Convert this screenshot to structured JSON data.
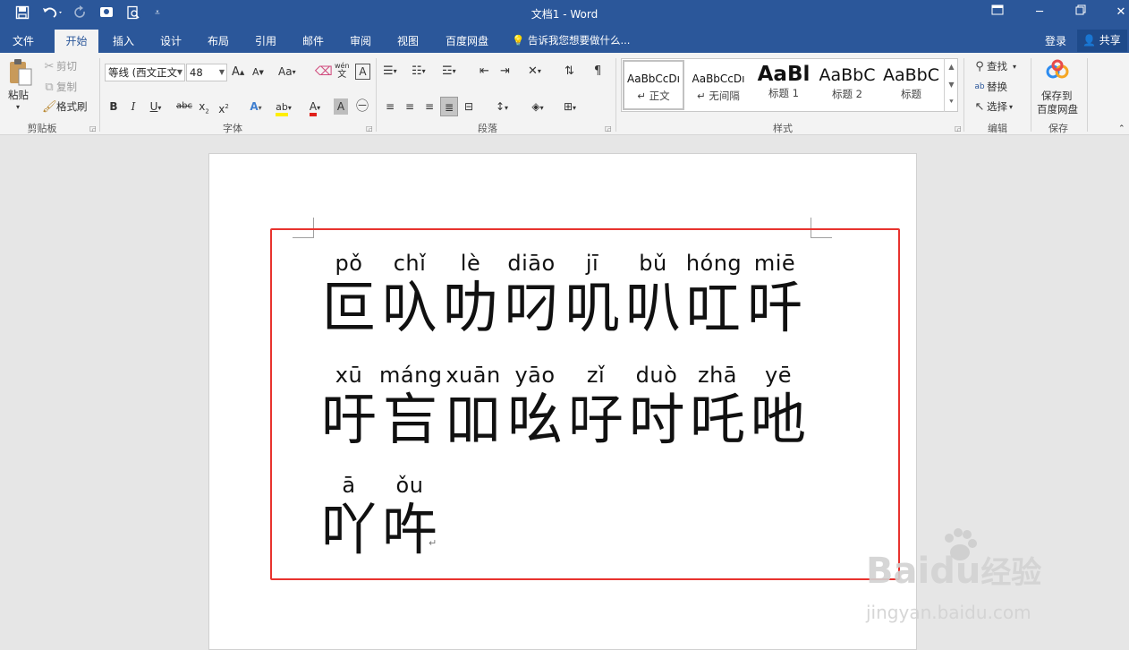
{
  "window": {
    "title": "文档1 - Word"
  },
  "tabs": [
    "文件",
    "开始",
    "插入",
    "设计",
    "布局",
    "引用",
    "邮件",
    "审阅",
    "视图",
    "百度网盘"
  ],
  "active_tab": "开始",
  "tell_me": "告诉我您想要做什么...",
  "account": {
    "login": "登录",
    "share": "共享"
  },
  "ribbon": {
    "clipboard": {
      "paste": "粘贴",
      "cut": "剪切",
      "copy": "复制",
      "format_painter": "格式刷",
      "label": "剪贴板"
    },
    "font": {
      "font_name": "等线 (西文正文",
      "font_size": "48",
      "change_case": "Aa",
      "label": "字体",
      "phonetic": "wén",
      "phonetic_sub": "文"
    },
    "paragraph": {
      "label": "段落"
    },
    "styles": {
      "label": "样式",
      "items": [
        {
          "sample": "AaBbCcDı",
          "name": "正文"
        },
        {
          "sample": "AaBbCcDı",
          "name": "无间隔"
        },
        {
          "sample": "AaBl",
          "name": "标题 1"
        },
        {
          "sample": "AaBbC",
          "name": "标题 2"
        },
        {
          "sample": "AaBbC",
          "name": "标题"
        }
      ]
    },
    "editing": {
      "find": "查找",
      "replace": "替换",
      "select": "选择",
      "label": "编辑"
    },
    "save": {
      "save_to": "保存到",
      "baidu": "百度网盘",
      "label": "保存"
    }
  },
  "document": {
    "lines": [
      [
        {
          "py": "pǒ",
          "hz": "叵"
        },
        {
          "py": "chǐ",
          "hz": "叺"
        },
        {
          "py": "lè",
          "hz": "叻"
        },
        {
          "py": "diāo",
          "hz": "叼"
        },
        {
          "py": "jī",
          "hz": "叽"
        },
        {
          "py": "bǔ",
          "hz": "叭"
        },
        {
          "py": "hóng",
          "hz": "叿"
        },
        {
          "py": "miē",
          "hz": "吀"
        }
      ],
      [
        {
          "py": "xū",
          "hz": "吁"
        },
        {
          "py": "máng",
          "hz": "吂"
        },
        {
          "py": "xuān",
          "hz": "吅"
        },
        {
          "py": "yāo",
          "hz": "吆"
        },
        {
          "py": "zǐ",
          "hz": "吇"
        },
        {
          "py": "duò",
          "hz": "吋"
        },
        {
          "py": "zhā",
          "hz": "吒"
        },
        {
          "py": "yē",
          "hz": "吔"
        }
      ],
      [
        {
          "py": "ā",
          "hz": "吖"
        },
        {
          "py": "ǒu",
          "hz": "吘"
        }
      ]
    ],
    "paragraph_mark": "↵"
  },
  "watermark": {
    "brand": "Baidu",
    "brand_cn": "经验",
    "url": "jingyan.baidu.com"
  },
  "colors": {
    "accent": "#2b579a",
    "highlight_border": "#e8332e"
  }
}
